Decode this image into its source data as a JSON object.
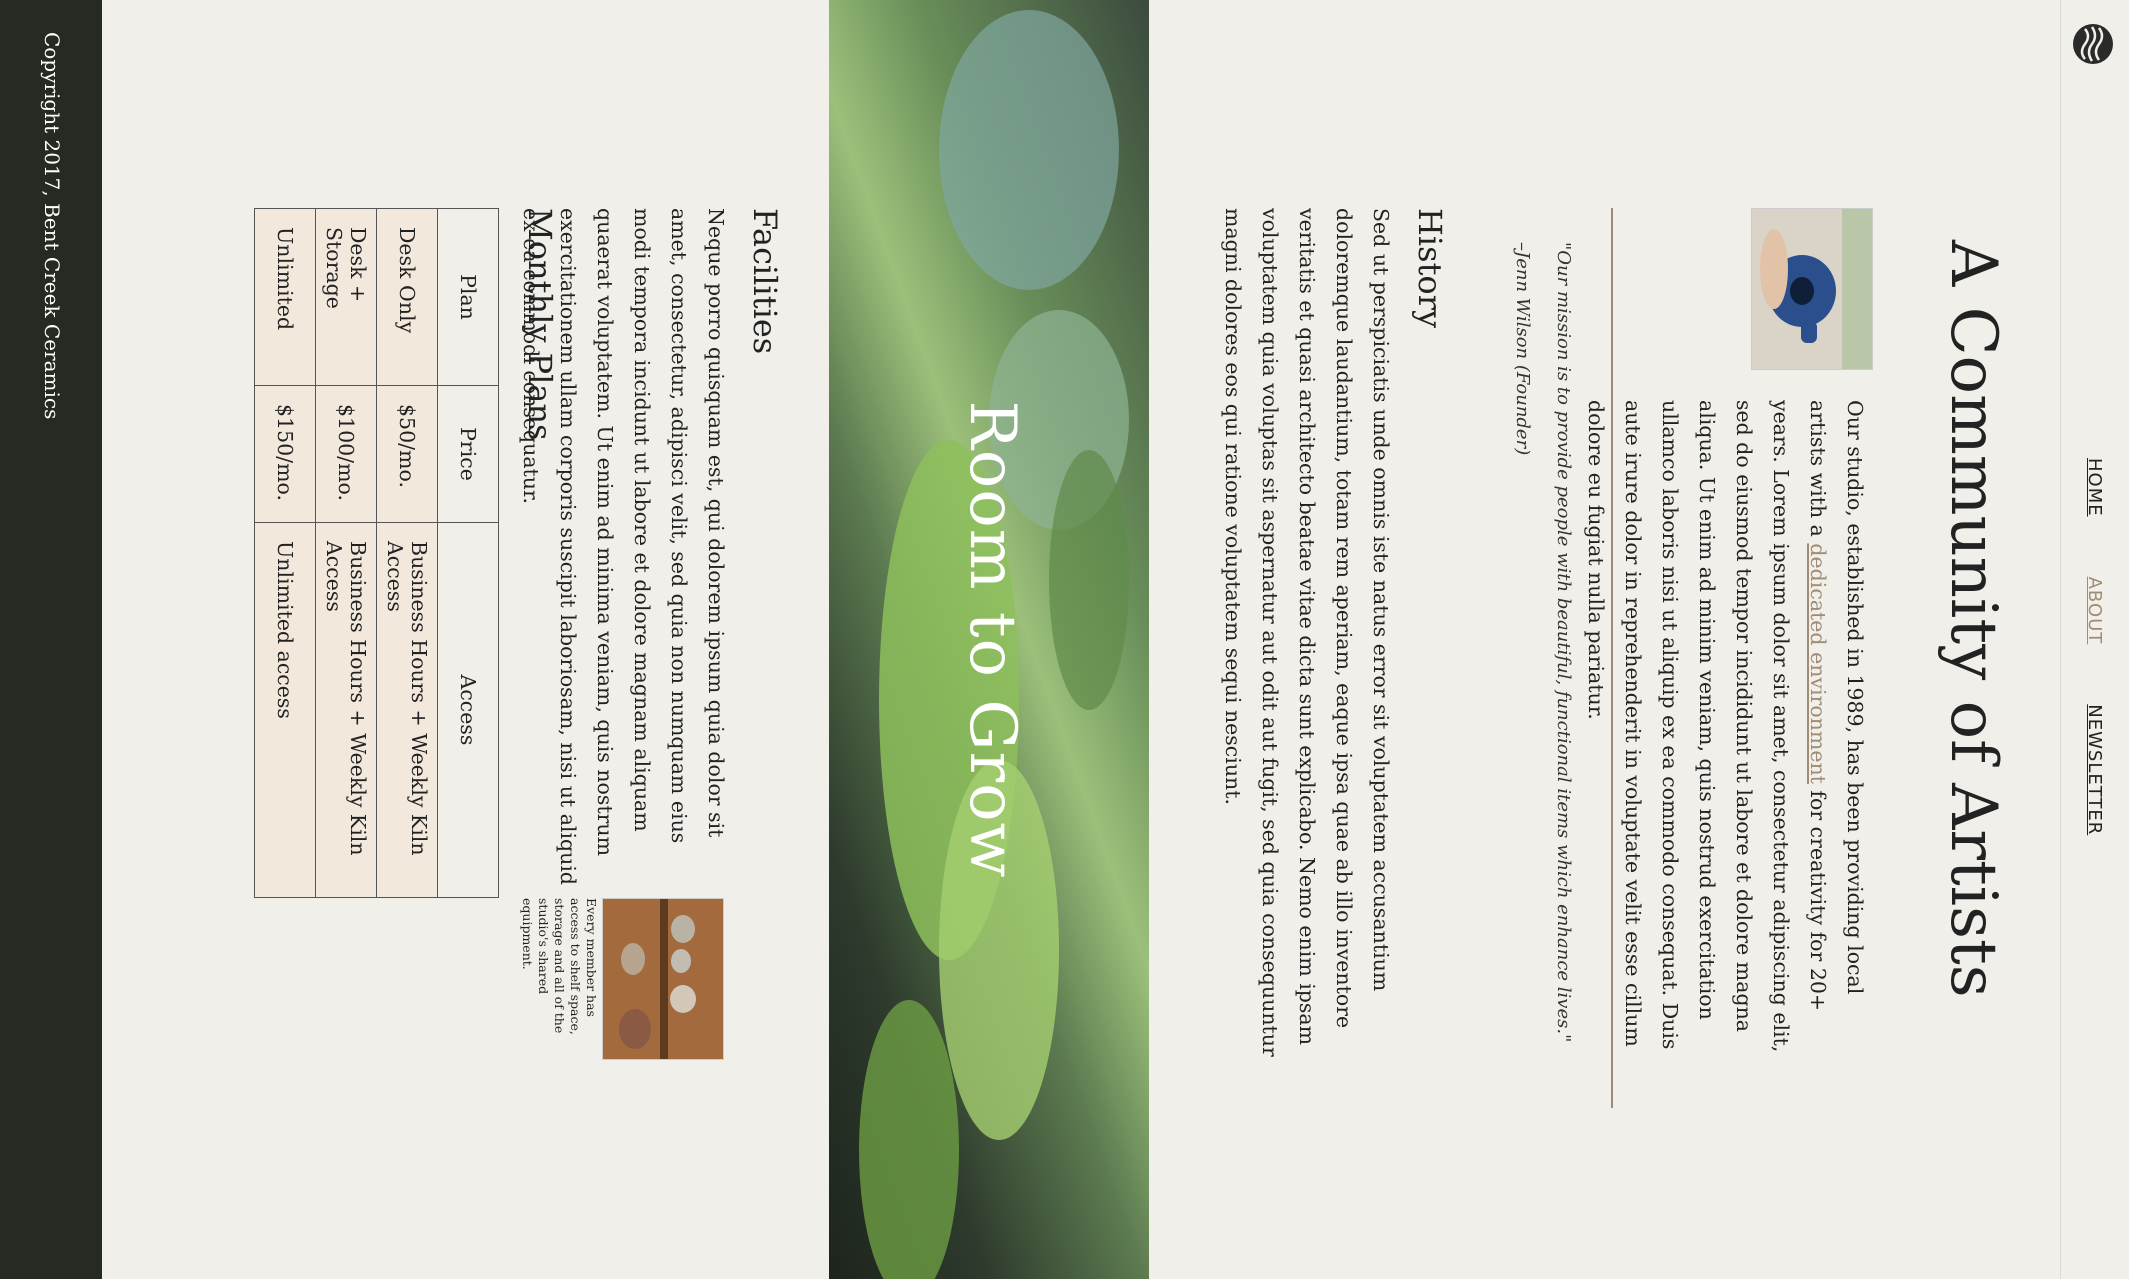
{
  "nav": {
    "items": [
      "HOME",
      "ABOUT",
      "NEWSLETTER"
    ],
    "active": "ABOUT"
  },
  "about": {
    "title": "A Community of Artists",
    "intro_before_link": "Our studio, established in 1989, has been providing local artists with a ",
    "link_text": "dedicated environment",
    "intro_after_link": " for creativity for 20+ years. Lorem ipsum dolor sit amet, consectetur adipiscing elit, sed do eiusmod tempor incididunt ut labore et dolore magna aliqua. Ut enim ad minim veniam, quis nostrud exercitation ullamco laboris nisi ut aliquip ex ea commodo consequat. Duis aute irure dolor in reprehenderit in voluptate velit esse cillum dolore eu fugiat nulla pariatur.",
    "quote": "\"Our mission is to provide people with beautiful, functional items which enhance lives.\"",
    "quote_author": "–Jenn Wilson (Founder)"
  },
  "history": {
    "heading": "History",
    "text": "Sed ut perspiciatis unde omnis iste natus error sit voluptatem accusantium doloremque laudantium, totam rem aperiam, eaque ipsa quae ab illo inventore veritatis et quasi architecto beatae vitae dicta sunt explicabo. Nemo enim ipsam voluptatem quia voluptas sit aspernatur aut odit aut fugit, sed quia consequuntur magni dolores eos qui ratione voluptatem sequi nesciunt."
  },
  "hero": {
    "title": "Room to Grow"
  },
  "facilities": {
    "heading": "Facilities",
    "text": "Neque porro quisquam est, qui dolorem ipsum quia dolor sit amet, consectetur, adipisci velit, sed quia non numquam eius modi tempora incidunt ut labore et dolore magnam aliquam quaerat voluptatem. Ut enim ad minima veniam, quis nostrum exercitationem ullam corporis suscipit laboriosam, nisi ut aliquid ex ea commodi consequatur.",
    "caption": "Every member has access to shelf space, storage and all of the studio's shared equipment."
  },
  "plans": {
    "heading": "Monthly Plans",
    "headers": [
      "Plan",
      "Price",
      "Access"
    ],
    "rows": [
      [
        "Desk Only",
        "$50/mo.",
        "Business Hours + Weekly Kiln Access"
      ],
      [
        "Desk + Storage",
        "$100/mo.",
        "Business Hours + Weekly Kiln Access"
      ],
      [
        "Unlimited",
        "$150/mo.",
        "Unlimited access"
      ]
    ]
  },
  "footer": {
    "copyright": "Copyright 2017, Bent Creek Ceramics"
  },
  "colors": {
    "background": "#f0efe9",
    "accent": "#a08b74",
    "footer": "#252a22"
  }
}
